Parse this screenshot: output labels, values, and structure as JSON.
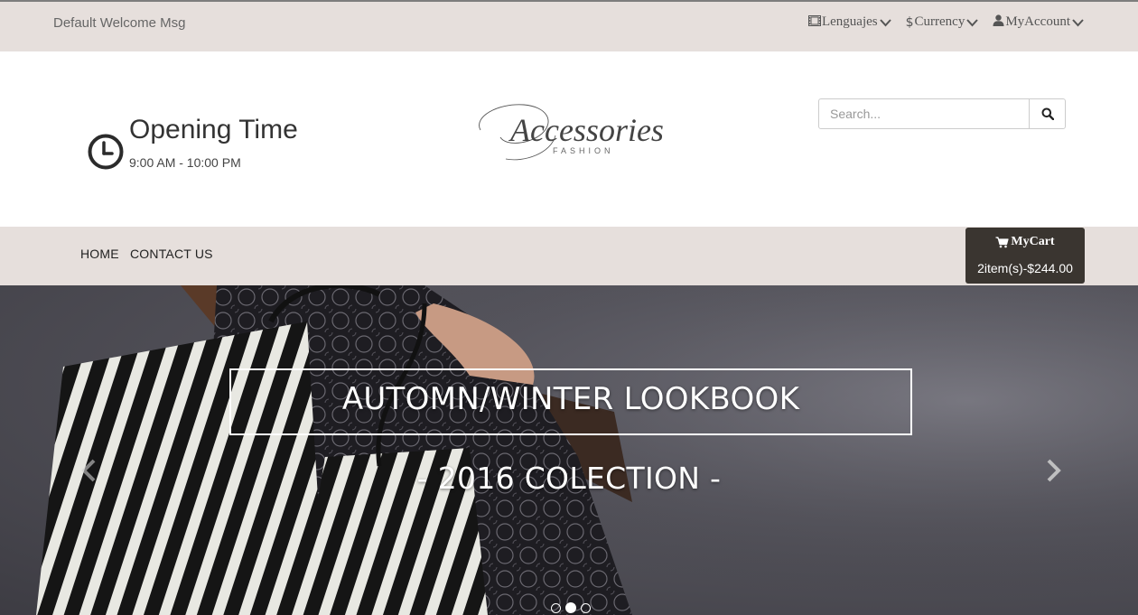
{
  "topbar": {
    "welcome": "Default Welcome Msg",
    "menu": [
      {
        "icon": "film-icon",
        "glyph": "🎞",
        "label": "Lenguajes"
      },
      {
        "icon": "dollar-icon",
        "glyph": "$",
        "label": "Currency"
      },
      {
        "icon": "user-icon",
        "glyph": "👤",
        "label": "MyAccount"
      }
    ]
  },
  "header": {
    "opening_title": "Opening Time",
    "opening_hours": "9:00 AM - 10:00 PM",
    "logo": {
      "script": "Accessories",
      "sub": "FASHION"
    },
    "search": {
      "placeholder": "Search..."
    }
  },
  "nav": {
    "links": [
      "HOME",
      "CONTACT US"
    ]
  },
  "cart": {
    "title": "MyCart",
    "summary": "2item(s)-$244.00"
  },
  "hero": {
    "title": "AUTOMN/WINTER LOOKBOOK",
    "subtitle": "- 2016 COLECTION -",
    "slides": 3,
    "active_slide": 2
  },
  "colors": {
    "bar_bg": "#e6dfdc",
    "cart_bg": "#3a3530",
    "text": "#333333"
  }
}
